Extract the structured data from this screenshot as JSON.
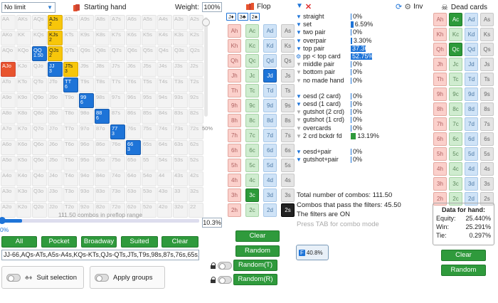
{
  "left": {
    "limit_select": "No limit",
    "starting_hand_label": "Starting hand",
    "weight_label": "Weight:",
    "weight_value": "100%",
    "slider_mid_label": "50%",
    "combos_caption": "111.50 combos in preflop range",
    "range_slider_value": "0%",
    "range_pct": "10.3%",
    "range_progress": 10.3,
    "buttons": [
      "All",
      "Pocket",
      "Broadway",
      "Suited",
      "Clear"
    ],
    "range_text": "JJ-66,AQs-ATs,A5s-A4s,KQs-KTs,QJs-QTs,JTs,T9s,98s,87s,76s,65s,A",
    "suit_selection_label": "Suit selection",
    "apply_groups_label": "Apply groups"
  },
  "matrix": [
    [
      "AA",
      "AKs",
      "AQs",
      "AJs",
      "ATs",
      "A9s",
      "A8s",
      "A7s",
      "A6s",
      "A5s",
      "A4s",
      "A3s",
      "A2s"
    ],
    [
      "AKo",
      "KK",
      "KQs",
      "KJs",
      "KTs",
      "K9s",
      "K8s",
      "K7s",
      "K6s",
      "K5s",
      "K4s",
      "K3s",
      "K2s"
    ],
    [
      "AQo",
      "KQo",
      "QQ",
      "QJs",
      "QTs",
      "Q9s",
      "Q8s",
      "Q7s",
      "Q6s",
      "Q5s",
      "Q4s",
      "Q3s",
      "Q2s"
    ],
    [
      "AJo",
      "KJo",
      "QJo",
      "JJ",
      "JTs",
      "J9s",
      "J8s",
      "J7s",
      "J6s",
      "J5s",
      "J4s",
      "J3s",
      "J2s"
    ],
    [
      "ATo",
      "KTo",
      "QTo",
      "JTo",
      "TT",
      "T9s",
      "T8s",
      "T7s",
      "T6s",
      "T5s",
      "T4s",
      "T3s",
      "T2s"
    ],
    [
      "A9o",
      "K9o",
      "Q9o",
      "J9o",
      "T9o",
      "99",
      "98s",
      "97s",
      "96s",
      "95s",
      "94s",
      "93s",
      "92s"
    ],
    [
      "A8o",
      "K8o",
      "Q8o",
      "J8o",
      "T8o",
      "98o",
      "88",
      "87s",
      "86s",
      "85s",
      "84s",
      "83s",
      "82s"
    ],
    [
      "A7o",
      "K7o",
      "Q7o",
      "J7o",
      "T7o",
      "97o",
      "87o",
      "77",
      "76s",
      "75s",
      "74s",
      "73s",
      "72s"
    ],
    [
      "A6o",
      "K6o",
      "Q6o",
      "J6o",
      "T6o",
      "96o",
      "86o",
      "76o",
      "66",
      "65s",
      "64s",
      "63s",
      "62s"
    ],
    [
      "A5o",
      "K5o",
      "Q5o",
      "J5o",
      "T5o",
      "95o",
      "85o",
      "75o",
      "65o",
      "55",
      "54s",
      "53s",
      "52s"
    ],
    [
      "A4o",
      "K4o",
      "Q4o",
      "J4o",
      "T4o",
      "94o",
      "84o",
      "74o",
      "64o",
      "54o",
      "44",
      "43s",
      "42s"
    ],
    [
      "A3o",
      "K3o",
      "Q3o",
      "J3o",
      "T3o",
      "93o",
      "83o",
      "73o",
      "63o",
      "53o",
      "43o",
      "33",
      "32s"
    ],
    [
      "A2o",
      "K2o",
      "Q2o",
      "J2o",
      "T2o",
      "92o",
      "82o",
      "72o",
      "62o",
      "52o",
      "42o",
      "32o",
      "22"
    ]
  ],
  "matrix_selected": [
    {
      "r": 0,
      "c": 3,
      "color": "yellow",
      "sub": "2"
    },
    {
      "r": 1,
      "c": 3,
      "color": "yellow",
      "sub": "2"
    },
    {
      "r": 2,
      "c": 2,
      "color": "blue",
      "sub": "1.50"
    },
    {
      "r": 2,
      "c": 3,
      "color": "yellow",
      "sub": "2"
    },
    {
      "r": 3,
      "c": 0,
      "color": "red",
      "sub": ""
    },
    {
      "r": 3,
      "c": 3,
      "color": "blue",
      "sub": "3"
    },
    {
      "r": 3,
      "c": 4,
      "color": "yellow",
      "sub": "3"
    },
    {
      "r": 4,
      "c": 4,
      "color": "blue",
      "sub": "6"
    },
    {
      "r": 5,
      "c": 5,
      "color": "blue",
      "sub": "6"
    },
    {
      "r": 6,
      "c": 6,
      "color": "blue",
      "sub": "6"
    },
    {
      "r": 7,
      "c": 7,
      "color": "blue",
      "sub": "3"
    },
    {
      "r": 8,
      "c": 8,
      "color": "blue",
      "sub": "3"
    }
  ],
  "flop": {
    "title": "Flop",
    "chips": [
      "J♦",
      "3♣",
      "2♠"
    ],
    "rows": [
      [
        "Ah",
        "Ac",
        "Ad",
        "As"
      ],
      [
        "Kh",
        "Kc",
        "Kd",
        "Ks"
      ],
      [
        "Qh",
        "Qc",
        "Qd",
        "Qs"
      ],
      [
        "Jh",
        "Jc",
        "Jd",
        "Js"
      ],
      [
        "Th",
        "Tc",
        "Td",
        "Ts"
      ],
      [
        "9h",
        "9c",
        "9d",
        "9s"
      ],
      [
        "8h",
        "8c",
        "8d",
        "8s"
      ],
      [
        "7h",
        "7c",
        "7d",
        "7s"
      ],
      [
        "6h",
        "6c",
        "6d",
        "6s"
      ],
      [
        "5h",
        "5c",
        "5d",
        "5s"
      ],
      [
        "4h",
        "4c",
        "4d",
        "4s"
      ],
      [
        "3h",
        "3c",
        "3d",
        "3s"
      ],
      [
        "2h",
        "2c",
        "2d",
        "2s"
      ]
    ],
    "selected": [
      "Jd",
      "3c",
      "2s"
    ],
    "buttons": [
      "Clear",
      "Random",
      "Random(T)",
      "Random(R)"
    ]
  },
  "filters": {
    "rows": [
      {
        "label": "straight",
        "value": "0%",
        "pct": 0,
        "color": "#1e74d8"
      },
      {
        "label": "set",
        "value": "6.59%",
        "pct": 6.59,
        "color": "#1e74d8"
      },
      {
        "label": "two pair",
        "value": "0%",
        "pct": 0,
        "color": "#1e74d8"
      },
      {
        "label": "overpair",
        "value": "3.30%",
        "pct": 3.3,
        "color": "#1e74d8"
      },
      {
        "label": "top pair",
        "value": "37.36%",
        "pct": 37.36,
        "color": "#1e74d8"
      },
      {
        "label": "pp < top card",
        "value": "52.75%",
        "pct": 52.75,
        "color": "#1e74d8"
      },
      {
        "label": "middle pair",
        "value": "0%",
        "pct": 0,
        "color": "#1e74d8"
      },
      {
        "label": "bottom pair",
        "value": "0%",
        "pct": 0,
        "color": "#1e74d8"
      },
      {
        "label": "no made hand",
        "value": "0%",
        "pct": 0,
        "color": "#1e74d8"
      },
      {
        "label": "",
        "value": "",
        "pct": 0,
        "color": ""
      },
      {
        "label": "oesd (2 card)",
        "value": "0%",
        "pct": 0,
        "color": "#1e74d8"
      },
      {
        "label": "oesd (1 card)",
        "value": "0%",
        "pct": 0,
        "color": "#1e74d8"
      },
      {
        "label": "gutshot (2 crd)",
        "value": "0%",
        "pct": 0,
        "color": "#1e74d8"
      },
      {
        "label": "gutshot (1 crd)",
        "value": "0%",
        "pct": 0,
        "color": "#1e74d8"
      },
      {
        "label": "overcards",
        "value": "0%",
        "pct": 0,
        "color": "#1e74d8"
      },
      {
        "label": "2 crd bckdr fd",
        "value": "13.19%",
        "pct": 13.19,
        "color": "#2f9a3c"
      },
      {
        "label": "",
        "value": "",
        "pct": 0,
        "color": ""
      },
      {
        "label": "oesd+pair",
        "value": "0%",
        "pct": 0,
        "color": "#1e74d8"
      },
      {
        "label": "gutshot+pair",
        "value": "0%",
        "pct": 0,
        "color": "#1e74d8"
      }
    ],
    "grey_rows": [
      6,
      7,
      8,
      12,
      13,
      14,
      15
    ],
    "total_combos": "Total number of combos: 111.50",
    "pass_combos": "Combos that pass the filters: 45.50",
    "filters_on": "The filters are ON",
    "tab_hint": "Press TAB for combo mode",
    "filter_badge": "40.8%",
    "filter_badge_label": "F"
  },
  "dead": {
    "inv_label": "Inv",
    "title": "Dead cards",
    "rows": [
      [
        "Ah",
        "Ac",
        "Ad",
        "As"
      ],
      [
        "Kh",
        "Kc",
        "Kd",
        "Ks"
      ],
      [
        "Qh",
        "Qc",
        "Qd",
        "Qs"
      ],
      [
        "Jh",
        "Jc",
        "Jd",
        "Js"
      ],
      [
        "Th",
        "Tc",
        "Td",
        "Ts"
      ],
      [
        "9h",
        "9c",
        "9d",
        "9s"
      ],
      [
        "8h",
        "8c",
        "8d",
        "8s"
      ],
      [
        "7h",
        "7c",
        "7d",
        "7s"
      ],
      [
        "6h",
        "6c",
        "6d",
        "6s"
      ],
      [
        "5h",
        "5c",
        "5d",
        "5s"
      ],
      [
        "4h",
        "4c",
        "4d",
        "4s"
      ],
      [
        "3h",
        "3c",
        "3d",
        "3s"
      ],
      [
        "2h",
        "2c",
        "2d",
        "2s"
      ]
    ],
    "selected": [
      "Ac",
      "Qc"
    ],
    "hand_box": {
      "title": "Data for hand:",
      "equity_label": "Equity:",
      "equity": "25.440%",
      "win_label": "Win:",
      "win": "25.291%",
      "tie_label": "Tie:",
      "tie": "0.297%"
    },
    "buttons": [
      "Clear",
      "Random"
    ]
  }
}
